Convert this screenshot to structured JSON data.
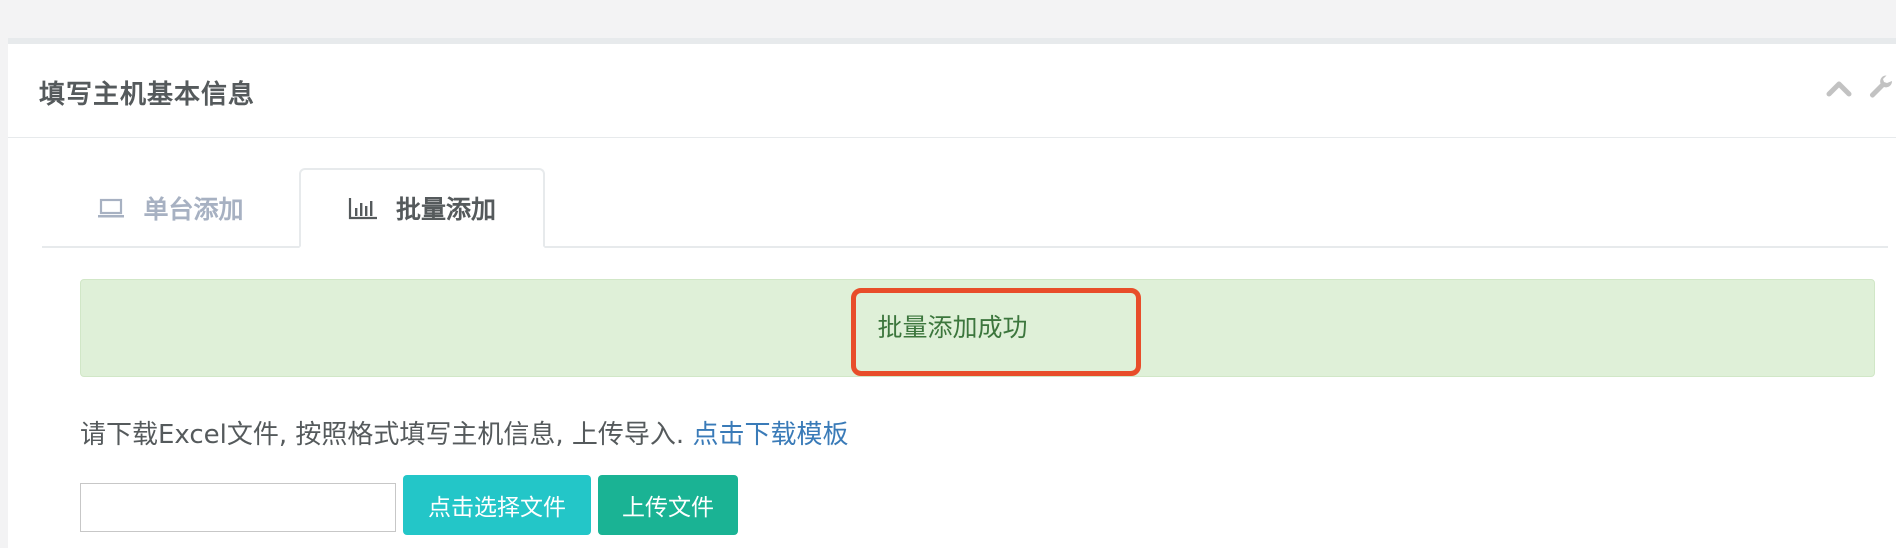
{
  "panel": {
    "title": "填写主机基本信息",
    "tools": {
      "collapse_icon": "chevron-up-icon",
      "config_icon": "wrench-icon"
    }
  },
  "tabs": [
    {
      "label": "单台添加",
      "icon": "laptop-icon",
      "active": false
    },
    {
      "label": "批量添加",
      "icon": "bar-chart-icon",
      "active": true
    }
  ],
  "alert": {
    "message": "批量添加成功",
    "type": "success"
  },
  "instructions": {
    "text": "请下载Excel文件, 按照格式填写主机信息, 上传导入.",
    "link_label": "点击下载模板"
  },
  "upload": {
    "file_value": "",
    "choose_label": "点击选择文件",
    "upload_label": "上传文件"
  },
  "colors": {
    "alert_bg": "#dff0d8",
    "alert_text": "#3c763d",
    "highlight": "#e84d2a",
    "choose_button": "#23c6c8",
    "upload_button": "#1ab394",
    "link": "#3a7bb8"
  }
}
